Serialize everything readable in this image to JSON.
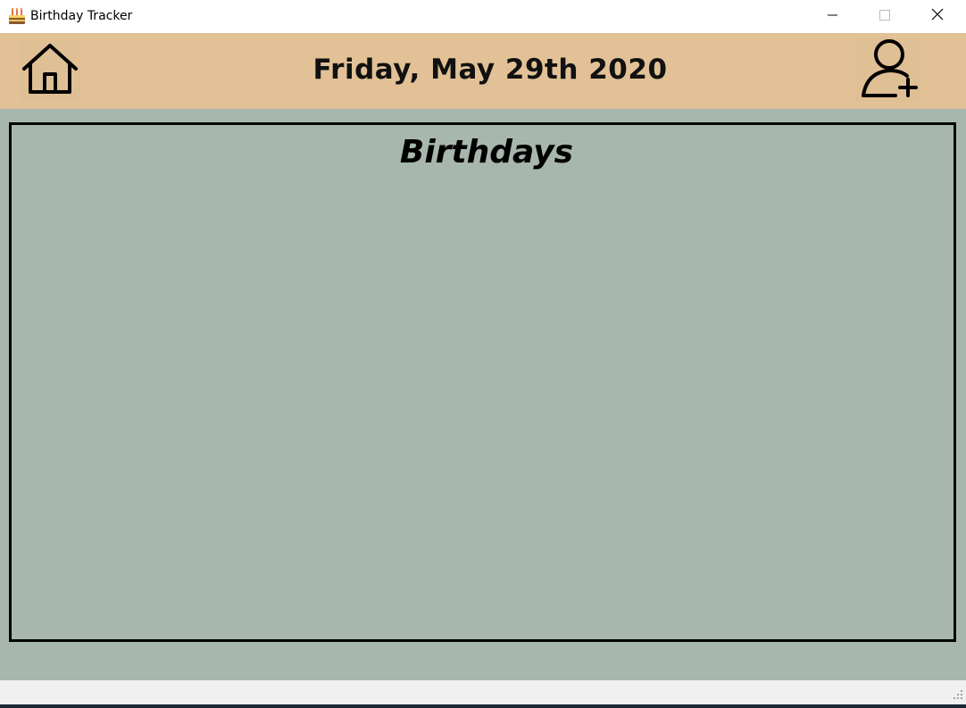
{
  "window": {
    "title": "Birthday Tracker",
    "app_icon": "birthday-cake-icon",
    "controls": [
      "minimize-icon",
      "maximize-icon",
      "close-icon"
    ]
  },
  "header": {
    "date": "Friday, May 29th 2020",
    "home_icon": "home-icon",
    "add_user_icon": "add-user-icon",
    "background": "#e2c196"
  },
  "main": {
    "panel_title": "Birthdays",
    "background": "#a7b7ad"
  }
}
